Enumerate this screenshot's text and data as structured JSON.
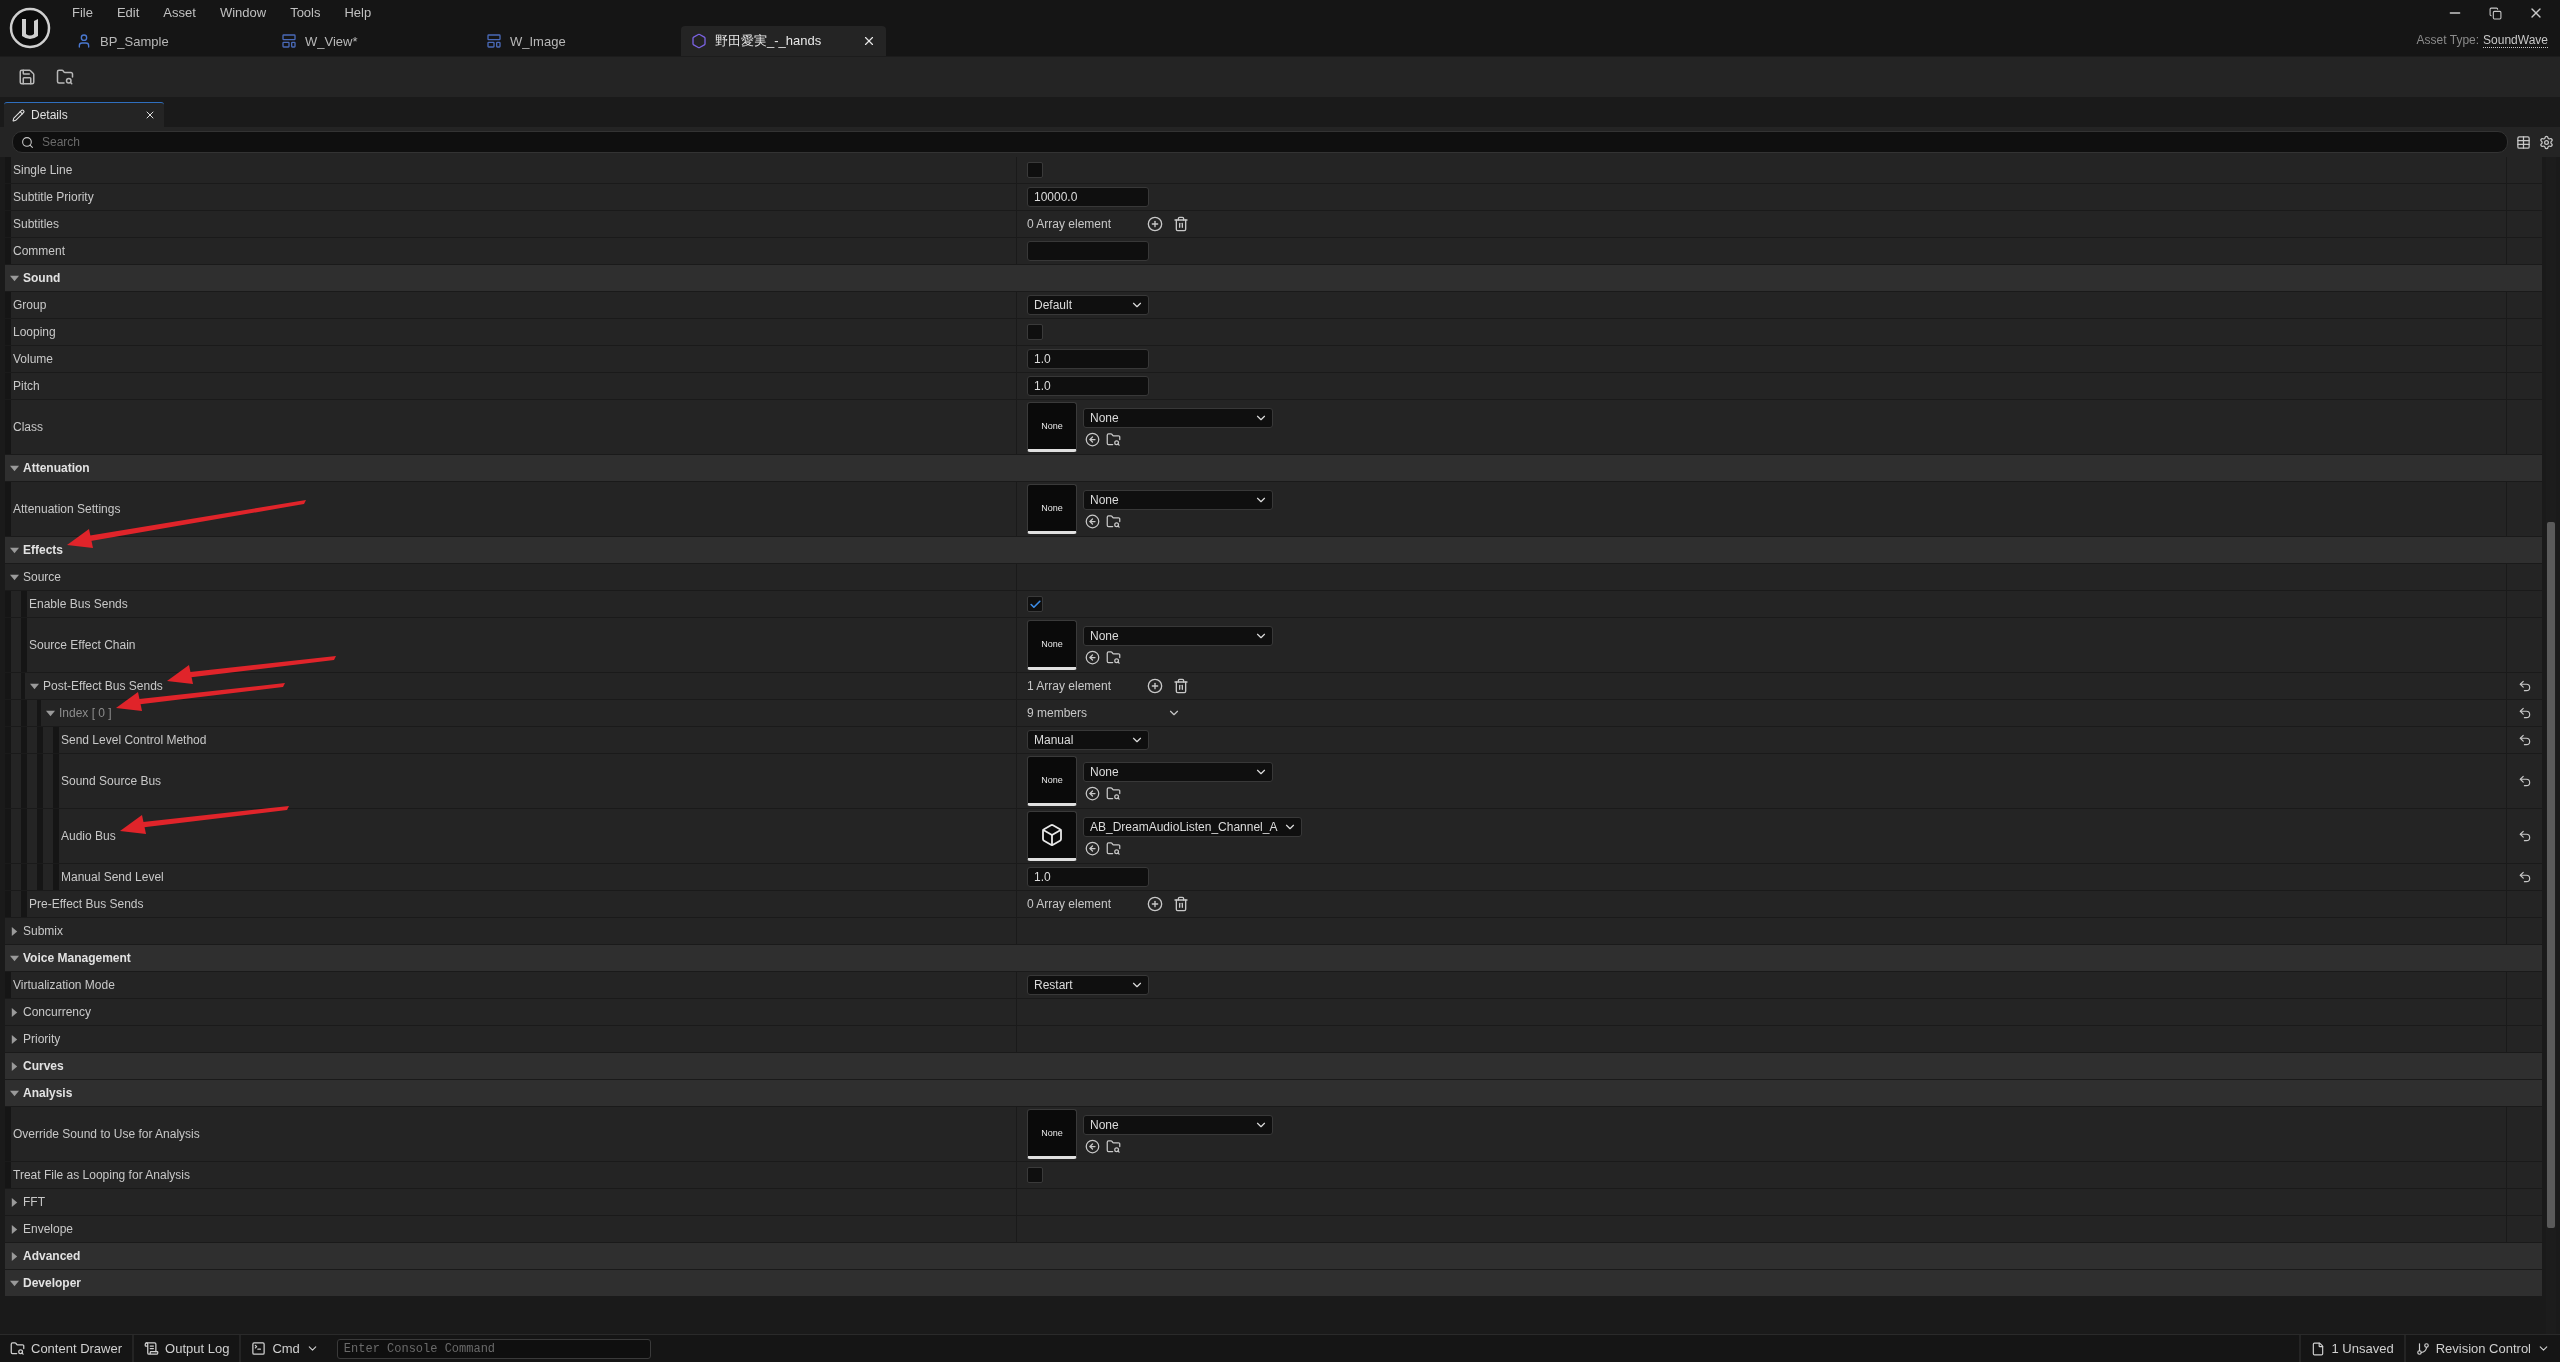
{
  "title_bar": {
    "menu": [
      "File",
      "Edit",
      "Asset",
      "Window",
      "Tools",
      "Help"
    ],
    "tabs": [
      {
        "label": "BP_Sample",
        "kind": "blueprint",
        "selected": false
      },
      {
        "label": "W_View*",
        "kind": "widget",
        "selected": false
      },
      {
        "label": "W_Image",
        "kind": "widget",
        "selected": false
      },
      {
        "label": "野田愛実_-_hands",
        "kind": "sound",
        "selected": true
      }
    ],
    "asset_type_label": "Asset Type:",
    "asset_type": "SoundWave"
  },
  "details": {
    "tab": "Details",
    "search": {
      "placeholder": "Search"
    },
    "rows": [
      {
        "kind": "property",
        "label": "Single Line",
        "value": {
          "kind": "checkbox",
          "checked": false
        },
        "reset": false,
        "annotated": false
      },
      {
        "kind": "property",
        "label": "Subtitle Priority",
        "value": {
          "kind": "number",
          "text": "10000.0"
        },
        "reset": false,
        "annotated": false
      },
      {
        "kind": "property",
        "label": "Subtitles",
        "value": {
          "kind": "array",
          "text": "0 Array element"
        },
        "reset": false,
        "annotated": false
      },
      {
        "kind": "property",
        "label": "Comment",
        "value": {
          "kind": "textbox"
        },
        "reset": false,
        "annotated": false
      },
      {
        "kind": "category",
        "label": "Sound",
        "expanded": true,
        "annotated": false,
        "children": [
          {
            "kind": "property",
            "label": "Group",
            "value": {
              "kind": "combo",
              "text": "Default"
            },
            "reset": false,
            "annotated": false
          },
          {
            "kind": "property",
            "label": "Looping",
            "value": {
              "kind": "checkbox",
              "checked": false
            },
            "reset": false,
            "annotated": false
          },
          {
            "kind": "property",
            "label": "Volume",
            "value": {
              "kind": "number",
              "text": "1.0"
            },
            "reset": false,
            "annotated": false
          },
          {
            "kind": "property",
            "label": "Pitch",
            "value": {
              "kind": "number",
              "text": "1.0"
            },
            "reset": false,
            "annotated": false
          },
          {
            "kind": "property",
            "label": "Class",
            "value": {
              "kind": "asset",
              "thumb": {
                "kind": "empty",
                "label": "None"
              },
              "text": "None"
            },
            "reset": false,
            "annotated": false
          }
        ]
      },
      {
        "kind": "category",
        "label": "Attenuation",
        "expanded": true,
        "annotated": false,
        "children": [
          {
            "kind": "property",
            "label": "Attenuation Settings",
            "value": {
              "kind": "asset",
              "thumb": {
                "kind": "empty",
                "label": "None"
              },
              "text": "None"
            },
            "reset": false,
            "annotated": false
          }
        ]
      },
      {
        "kind": "category",
        "label": "Effects",
        "expanded": true,
        "annotated": true,
        "children": [
          {
            "kind": "group",
            "label": "Source",
            "expanded": true,
            "reset": false,
            "annotated": false,
            "children": [
              {
                "kind": "property",
                "label": "Enable Bus Sends",
                "value": {
                  "kind": "checkbox",
                  "checked": true
                },
                "reset": false,
                "annotated": false
              },
              {
                "kind": "property",
                "label": "Source Effect Chain",
                "value": {
                  "kind": "asset",
                  "thumb": {
                    "kind": "empty",
                    "label": "None"
                  },
                  "text": "None"
                },
                "reset": false,
                "annotated": false
              },
              {
                "kind": "group",
                "label": "Post-Effect Bus Sends",
                "expanded": true,
                "value": {
                  "kind": "array",
                  "text": "1 Array element"
                },
                "reset": true,
                "annotated": true,
                "children": [
                  {
                    "kind": "group",
                    "label": "Index [ 0 ]",
                    "expanded": true,
                    "value": {
                      "kind": "members",
                      "text": "9 members"
                    },
                    "reset": true,
                    "annotated": true,
                    "children": [
                      {
                        "kind": "property",
                        "label": "Send Level Control Method",
                        "value": {
                          "kind": "combo",
                          "text": "Manual"
                        },
                        "reset": true,
                        "annotated": false
                      },
                      {
                        "kind": "property",
                        "label": "Sound Source Bus",
                        "value": {
                          "kind": "asset",
                          "thumb": {
                            "kind": "empty",
                            "label": "None"
                          },
                          "text": "None"
                        },
                        "reset": true,
                        "annotated": false
                      },
                      {
                        "kind": "property",
                        "label": "Audio Bus",
                        "value": {
                          "kind": "asset",
                          "thumb": {
                            "kind": "cube"
                          },
                          "text": "AB_DreamAudioListen_Channel_A"
                        },
                        "reset": true,
                        "annotated": true
                      },
                      {
                        "kind": "property",
                        "label": "Manual Send Level",
                        "value": {
                          "kind": "number",
                          "text": "1.0"
                        },
                        "reset": true,
                        "annotated": false
                      }
                    ]
                  }
                ]
              },
              {
                "kind": "property",
                "label": "Pre-Effect Bus Sends",
                "value": {
                  "kind": "array",
                  "text": "0 Array element"
                },
                "reset": false,
                "annotated": false
              }
            ]
          },
          {
            "kind": "group",
            "label": "Submix",
            "expanded": false,
            "reset": false,
            "annotated": false
          }
        ]
      },
      {
        "kind": "category",
        "label": "Voice Management",
        "expanded": true,
        "annotated": false,
        "children": [
          {
            "kind": "property",
            "label": "Virtualization Mode",
            "value": {
              "kind": "combo",
              "text": "Restart"
            },
            "reset": false,
            "annotated": false
          },
          {
            "kind": "group",
            "label": "Concurrency",
            "expanded": false,
            "reset": false,
            "annotated": false
          },
          {
            "kind": "group",
            "label": "Priority",
            "expanded": false,
            "reset": false,
            "annotated": false
          }
        ]
      },
      {
        "kind": "category",
        "label": "Curves",
        "expanded": false,
        "annotated": false
      },
      {
        "kind": "category",
        "label": "Analysis",
        "expanded": true,
        "annotated": false,
        "children": [
          {
            "kind": "property",
            "label": "Override Sound to Use for Analysis",
            "value": {
              "kind": "asset",
              "thumb": {
                "kind": "empty",
                "label": "None"
              },
              "text": "None"
            },
            "reset": false,
            "annotated": false
          },
          {
            "kind": "property",
            "label": "Treat File as Looping for Analysis",
            "value": {
              "kind": "checkbox",
              "checked": false
            },
            "reset": false,
            "annotated": false
          },
          {
            "kind": "group",
            "label": "FFT",
            "expanded": false,
            "reset": false,
            "annotated": false
          },
          {
            "kind": "group",
            "label": "Envelope",
            "expanded": false,
            "reset": false,
            "annotated": false
          }
        ]
      },
      {
        "kind": "category",
        "label": "Advanced",
        "expanded": false,
        "annotated": false
      },
      {
        "kind": "category",
        "label": "Developer",
        "expanded": true,
        "annotated": false
      }
    ]
  },
  "status_bar": {
    "content_drawer": "Content Drawer",
    "output_log": "Output Log",
    "cmd": "Cmd",
    "console": {
      "placeholder": "Enter Console Command"
    },
    "unsaved": "1 Unsaved",
    "revision_control": "Revision Control"
  }
}
